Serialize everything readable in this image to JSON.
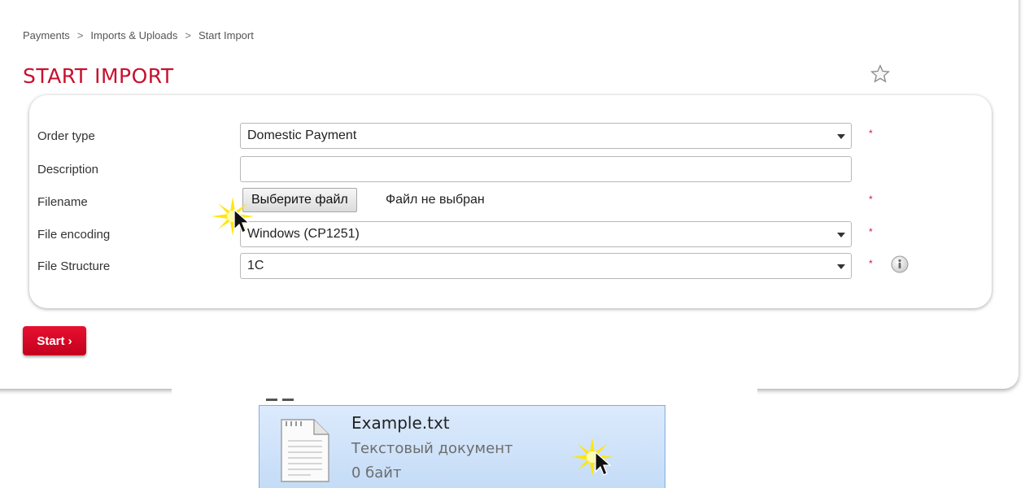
{
  "breadcrumb": {
    "items": [
      "Payments",
      "Imports & Uploads",
      "Start Import"
    ],
    "separator": ">"
  },
  "page": {
    "title": "START IMPORT"
  },
  "form": {
    "order_type": {
      "label": "Order type",
      "value": "Domestic Payment",
      "required_mark": "*"
    },
    "description": {
      "label": "Description",
      "value": ""
    },
    "filename": {
      "label": "Filename",
      "button_label": "Выберите файл",
      "status": "Файл не выбран",
      "required_mark": "*"
    },
    "file_encoding": {
      "label": "File encoding",
      "value": "Windows (CP1251)",
      "required_mark": "*"
    },
    "file_structure": {
      "label": "File Structure",
      "value": "1C",
      "required_mark": "*"
    }
  },
  "actions": {
    "start_label": "Start ›"
  },
  "explorer": {
    "file": {
      "name": "Example.txt",
      "type": "Текстовый документ",
      "size": "0 байт"
    }
  },
  "colors": {
    "accent": "#c8102e",
    "required": "#d41a3a",
    "selection": "#cce0f8"
  },
  "icons": [
    "star-icon",
    "info-icon",
    "dropdown-arrow-icon",
    "text-document-icon",
    "mouse-cursor-icon"
  ]
}
